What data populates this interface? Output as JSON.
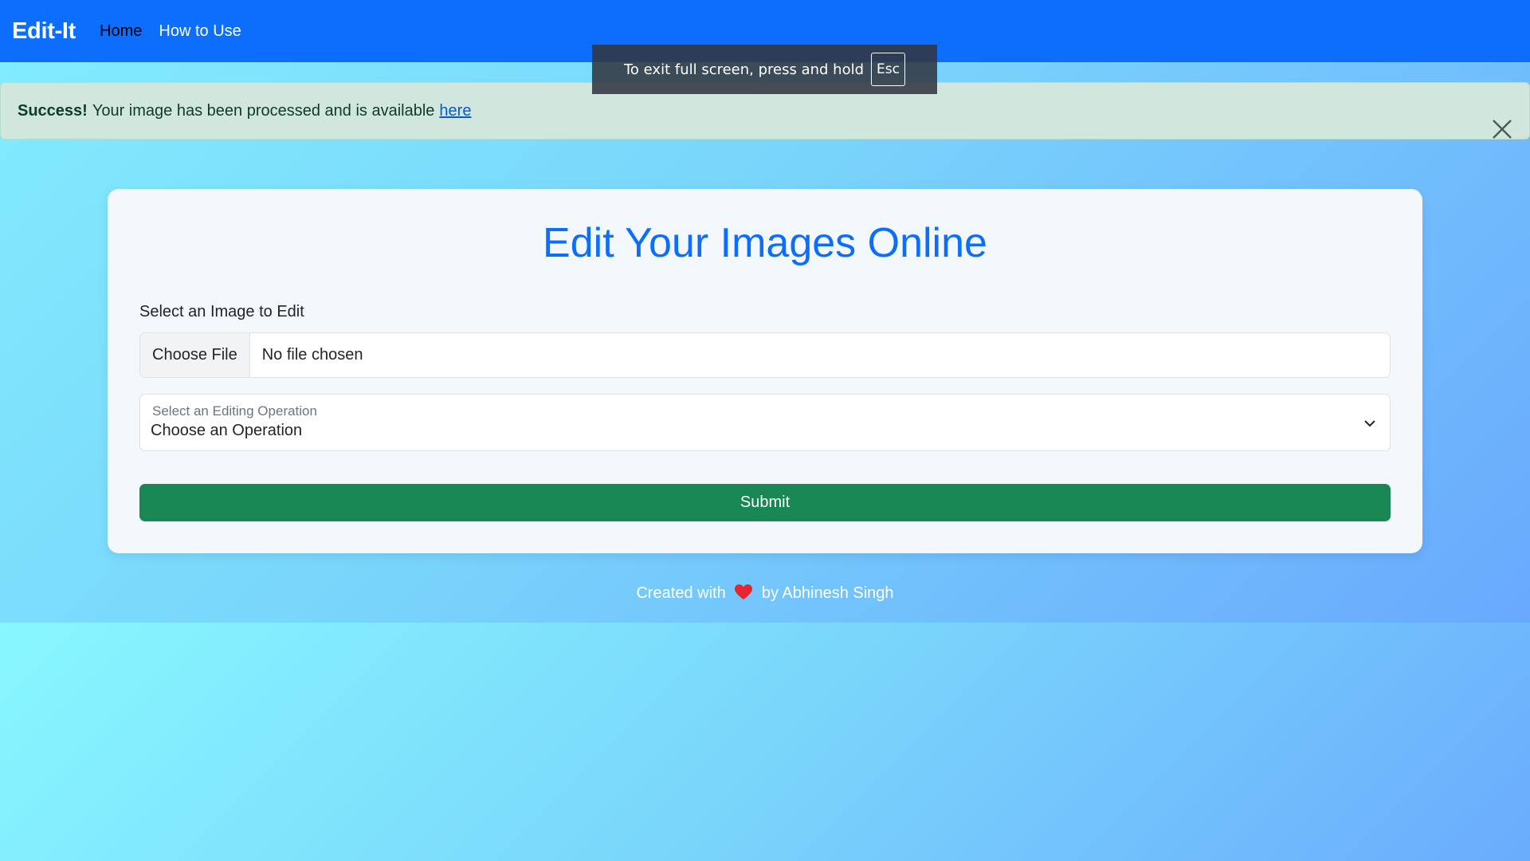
{
  "navbar": {
    "brand": "Edit-It",
    "links": [
      {
        "label": "Home",
        "active": true
      },
      {
        "label": "How to Use",
        "active": false
      }
    ],
    "bg_color": "#0d6efd"
  },
  "fullscreen_notice": {
    "text": "To exit full screen, press and hold",
    "key": "Esc"
  },
  "alert": {
    "strong": "Success!",
    "message": "Your image has been processed and is available",
    "link_text": "here",
    "close_icon": "close-icon"
  },
  "card": {
    "title": "Edit Your Images Online",
    "file_label": "Select an Image to Edit",
    "file_button": "Choose File",
    "file_status": "No file chosen",
    "select_label": "Select an Editing Operation",
    "select_value": "Choose an Operation",
    "submit_label": "Submit",
    "submit_color": "#198754"
  },
  "footer": {
    "prefix": "Created with",
    "suffix": "by Abhinesh Singh",
    "icon": "heart-icon"
  }
}
